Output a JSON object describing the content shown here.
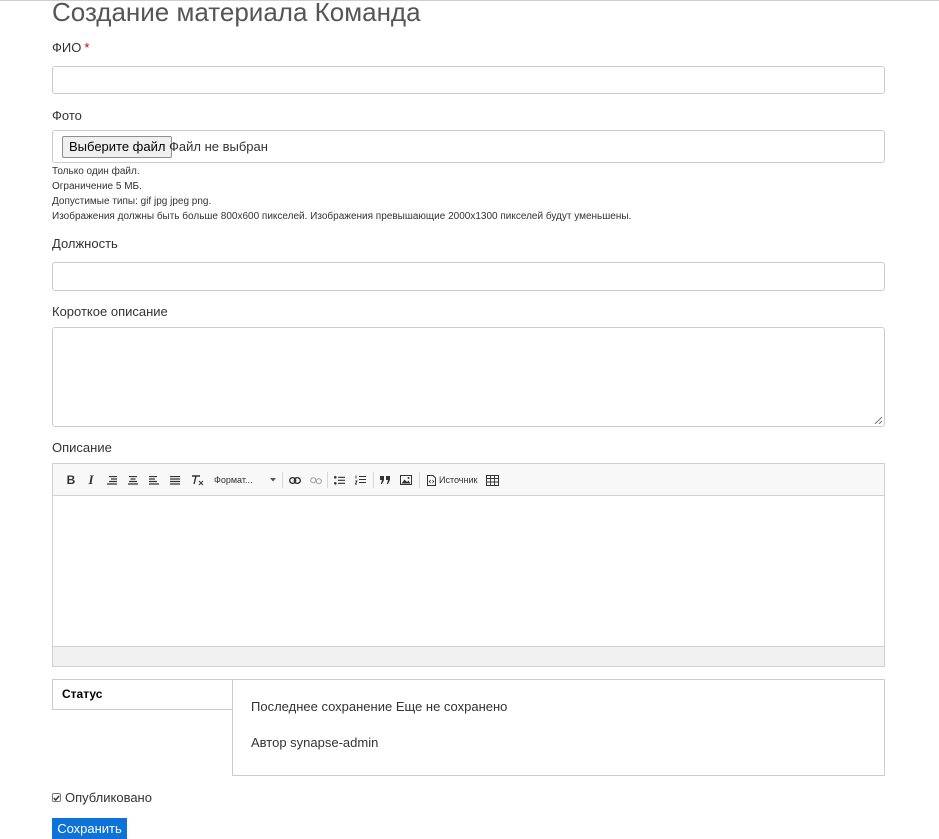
{
  "page": {
    "title": "Создание материала Команда"
  },
  "fields": {
    "fio": {
      "label": "ФИО",
      "required_mark": "*",
      "value": ""
    },
    "photo": {
      "label": "Фото",
      "button": "Выберите файл",
      "status": "Файл не выбран",
      "help": [
        "Только один файл.",
        "Ограничение 5 МБ.",
        "Допустимые типы: gif jpg jpeg png.",
        "Изображения должны быть больше 800x600 пикселей. Изображения превышающие 2000x1300 пикселей будут уменьшены."
      ]
    },
    "position": {
      "label": "Должность",
      "value": ""
    },
    "short_description": {
      "label": "Короткое описание",
      "value": ""
    },
    "description": {
      "label": "Описание",
      "toolbar": {
        "bold": "B",
        "italic": "I",
        "format": "Формат...",
        "source": "Источник",
        "icons": [
          "bold-icon",
          "italic-icon",
          "align-right-icon",
          "align-center-icon",
          "align-left-icon",
          "align-justify-icon",
          "remove-format-icon",
          "link-icon",
          "unlink-icon",
          "bulleted-list-icon",
          "numbered-list-icon",
          "blockquote-icon",
          "image-icon",
          "source-icon",
          "table-icon"
        ]
      }
    }
  },
  "status": {
    "tab": "Статус",
    "last_saved": "Последнее сохранение Еще не сохранено",
    "author": "Автор synapse-admin"
  },
  "published": {
    "label": "Опубликовано",
    "checked": true
  },
  "actions": {
    "save": "Сохранить"
  },
  "colors": {
    "primary_button": "#0d73d8",
    "required": "#c00000"
  }
}
